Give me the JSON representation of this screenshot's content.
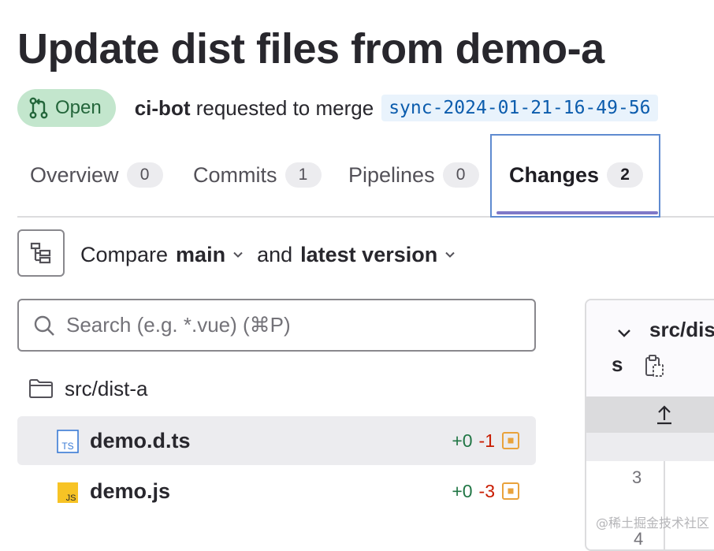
{
  "title": "Update dist files from demo-a",
  "status": {
    "label": "Open",
    "color": "#c3e6cd"
  },
  "meta": {
    "author": "ci-bot",
    "action_text": "requested to merge",
    "source_branch": "sync-2024-01-21-16-49-56"
  },
  "tabs": [
    {
      "label": "Overview",
      "count": "0"
    },
    {
      "label": "Commits",
      "count": "1"
    },
    {
      "label": "Pipelines",
      "count": "0"
    },
    {
      "label": "Changes",
      "count": "2",
      "active": true
    }
  ],
  "compare": {
    "prefix": "Compare",
    "base": "main",
    "joiner": "and",
    "version": "latest version"
  },
  "search": {
    "placeholder": "Search (e.g. *.vue) (⌘P)",
    "value": ""
  },
  "file_tree": {
    "folder": "src/dist-a",
    "files": [
      {
        "name": "demo.d.ts",
        "icon": "ts-file-icon",
        "added": "+0",
        "removed": "-1",
        "selected": true
      },
      {
        "name": "demo.js",
        "icon": "js-file-icon",
        "added": "+0",
        "removed": "-3",
        "selected": false
      }
    ]
  },
  "diff": {
    "path_start": "src/dis",
    "path_cont": "s",
    "line_numbers": [
      "3",
      "4"
    ]
  },
  "watermark": "@稀土掘金技术社区",
  "colors": {
    "accent": "#7e78c8",
    "focus": "#5f8bd0",
    "added": "#217645",
    "removed": "#c91c00",
    "modified": "#e9a23b"
  }
}
